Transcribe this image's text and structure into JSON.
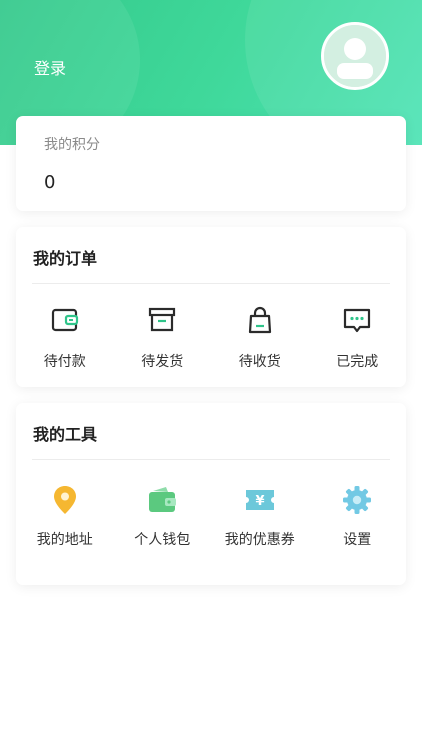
{
  "header": {
    "login_label": "登录"
  },
  "points": {
    "label": "我的积分",
    "value": "0"
  },
  "orders": {
    "title": "我的订单",
    "items": [
      {
        "label": "待付款",
        "icon": "wallet-icon"
      },
      {
        "label": "待发货",
        "icon": "box-icon"
      },
      {
        "label": "待收货",
        "icon": "shopping-bag-icon"
      },
      {
        "label": "已完成",
        "icon": "chat-dots-icon"
      }
    ]
  },
  "tools": {
    "title": "我的工具",
    "items": [
      {
        "label": "我的地址",
        "icon": "location-pin-icon"
      },
      {
        "label": "个人钱包",
        "icon": "wallet-icon"
      },
      {
        "label": "我的优惠券",
        "icon": "coupon-icon"
      },
      {
        "label": "设置",
        "icon": "gear-icon"
      }
    ]
  },
  "colors": {
    "brand_green": "#3fd89a",
    "icon_dark": "#2b2b2b",
    "icon_accent_green": "#2fc48a",
    "pin_yellow": "#f5b731",
    "wallet_green": "#5bc97f",
    "coupon_teal": "#6cc8da",
    "gear_blue": "#72c9e4"
  }
}
